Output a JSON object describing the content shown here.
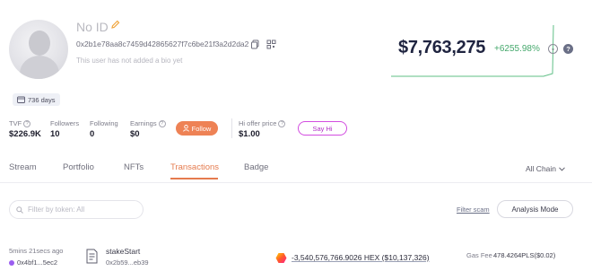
{
  "profile": {
    "name": "No ID",
    "address": "0x2b1e78aa8c7459d42865627f7c6be21f3a2d2da2",
    "bio": "This user has not added a bio yet",
    "days": "736 days"
  },
  "stats": [
    {
      "label": "TVF",
      "value": "$226.9K",
      "has_help": true
    },
    {
      "label": "Followers",
      "value": "10",
      "has_help": false
    },
    {
      "label": "Following",
      "value": "0",
      "has_help": false
    },
    {
      "label": "Earnings",
      "value": "$0",
      "has_help": true
    }
  ],
  "follow_button": "Follow",
  "hi_offer": {
    "label": "Hi offer price",
    "value": "$1.00"
  },
  "sayhi_button": "Say Hi",
  "portfolio": {
    "total_value": "$7,763,275",
    "change": "+6255.98%",
    "chart_color": "#5fbf86"
  },
  "tabs": {
    "items": [
      "Stream",
      "Portfolio",
      "NFTs",
      "Transactions",
      "Badge"
    ],
    "active": "Transactions"
  },
  "chain_filter": "All Chain",
  "filter": {
    "placeholder": "Filter by token: All"
  },
  "filter_scam": "Filter scam",
  "analysis_mode": "Analysis Mode",
  "transaction": {
    "time": "5mins 21secs ago",
    "from": "0x4bf1...5ec2",
    "method": "stakeStart",
    "method_address": "0x2b59...eb39",
    "amount": "-3,540,576,766.9026 HEX ($10,137,326)",
    "gas_label": "Gas Fee",
    "gas_value": "478.4264PLS($0.02)"
  },
  "colors": {
    "accent": "#e57b4e",
    "follow_bg": "#ee8255",
    "sayhi_border": "#d24de0",
    "positive": "#45a86c"
  }
}
